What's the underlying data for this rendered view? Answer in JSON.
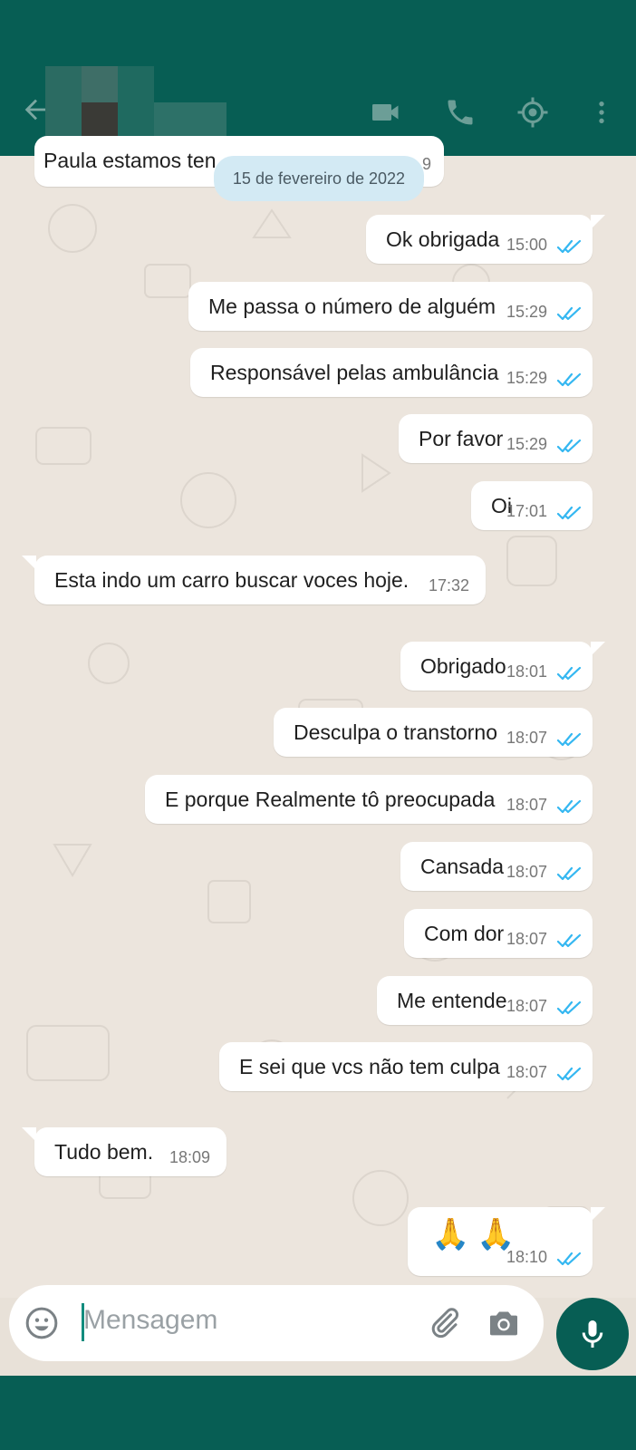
{
  "header": {
    "contact_name_blurred": true,
    "icons": [
      "back-arrow-icon",
      "video-call-icon",
      "voice-call-icon",
      "location-icon",
      "more-options-icon"
    ]
  },
  "date_separator": "15 de fevereiro de 2022",
  "partial_message": {
    "text": "Paula estamos ten",
    "time_fragment": "9"
  },
  "messages": [
    {
      "dir": "out",
      "text": "Ok obrigada",
      "time": "15:00"
    },
    {
      "dir": "out",
      "text": "Me passa o número de alguém",
      "time": "15:29"
    },
    {
      "dir": "out",
      "text": "Responsável pelas ambulância",
      "time": "15:29"
    },
    {
      "dir": "out",
      "text": "Por favor",
      "time": "15:29"
    },
    {
      "dir": "out",
      "text": "Oi",
      "time": "17:01"
    },
    {
      "dir": "in",
      "text": "Esta indo um carro buscar voces hoje.",
      "time": "17:32"
    },
    {
      "dir": "out",
      "text": "Obrigado",
      "time": "18:01"
    },
    {
      "dir": "out",
      "text": "Desculpa o transtorno",
      "time": "18:07"
    },
    {
      "dir": "out",
      "text": "E porque Realmente tô preocupada",
      "time": "18:07"
    },
    {
      "dir": "out",
      "text": "Cansada",
      "time": "18:07"
    },
    {
      "dir": "out",
      "text": "Com dor",
      "time": "18:07"
    },
    {
      "dir": "out",
      "text": "Me entende",
      "time": "18:07"
    },
    {
      "dir": "out",
      "text": "E sei que vcs não tem culpa",
      "time": "18:07"
    },
    {
      "dir": "in",
      "text": "Tudo bem.",
      "time": "18:09"
    },
    {
      "dir": "out",
      "text": "🙏🙏",
      "time": "18:10",
      "emoji": true
    }
  ],
  "input": {
    "placeholder": "Mensagem"
  },
  "colors": {
    "header": "#075e54",
    "tick": "#34b7f1",
    "bubble_out": "#ffffff",
    "bubble_in": "#ffffff",
    "date_pill": "#d3eaf4"
  }
}
